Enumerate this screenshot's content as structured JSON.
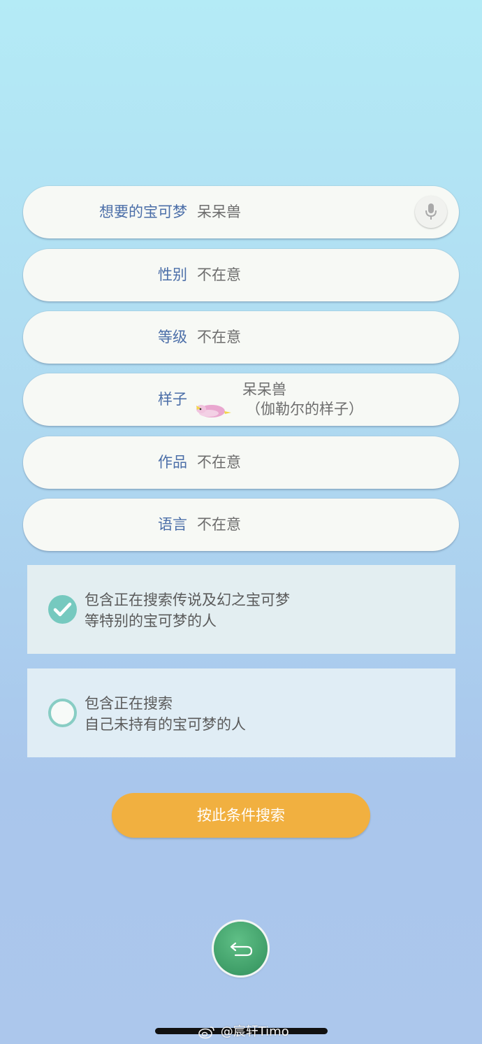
{
  "fields": {
    "pokemon": {
      "label": "想要的宝可梦",
      "value": "呆呆兽"
    },
    "gender": {
      "label": "性别",
      "value": "不在意"
    },
    "level": {
      "label": "等级",
      "value": "不在意"
    },
    "form": {
      "label": "样子",
      "name": "呆呆兽",
      "sub": "（伽勒尔的样子）"
    },
    "game": {
      "label": "作品",
      "value": "不在意"
    },
    "language": {
      "label": "语言",
      "value": "不在意"
    }
  },
  "options": [
    {
      "line1": "包含正在搜索传说及幻之宝可梦",
      "line2": "等特别的宝可梦的人",
      "checked": true
    },
    {
      "line1": "包含正在搜索",
      "line2": "自己未持有的宝可梦的人",
      "checked": false
    }
  ],
  "search_button": {
    "label": "按此条件搜索"
  },
  "watermark": {
    "text": "@宸轩Timo"
  },
  "icons": {
    "mic": "microphone-icon",
    "back": "return-arrow-icon",
    "check": "checkmark-icon",
    "sprite": "slowpoke-galar-sprite",
    "weibo": "weibo-logo-icon"
  },
  "colors": {
    "label": "#4b6ea8",
    "value": "#6d6d6d",
    "check_teal": "#76c9bf",
    "search_orange": "#f1b040",
    "back_green": "#3f9e68"
  }
}
